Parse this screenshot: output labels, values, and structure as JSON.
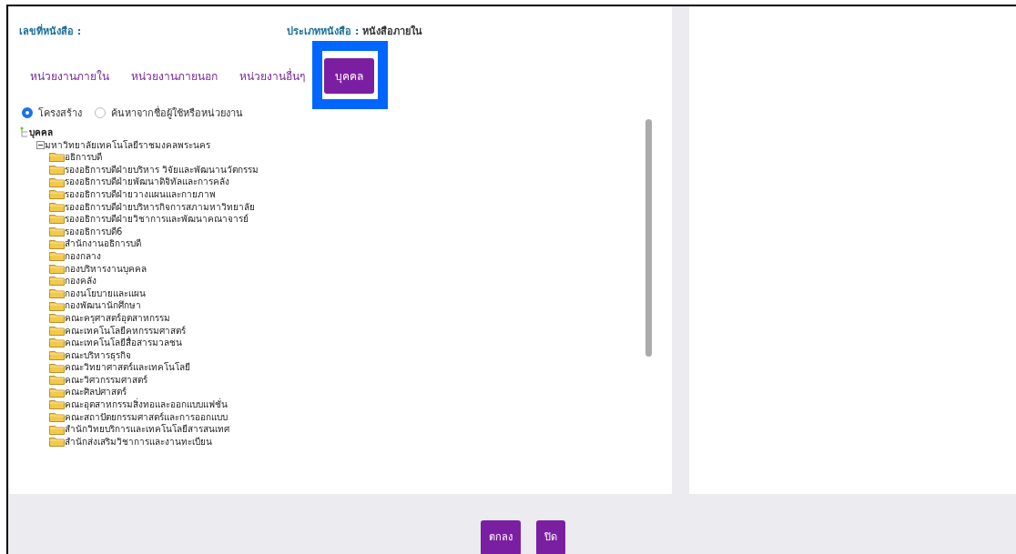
{
  "header": {
    "doc_number_label": "เลขที่หนังสือ :",
    "doc_type_label": "ประเภทหนังสือ :",
    "doc_type_value": "หนังสือภายใน"
  },
  "tabs": [
    {
      "label": "หน่วยงานภายใน",
      "selected": false,
      "highlighted": false
    },
    {
      "label": "หน่วยงานภายนอก",
      "selected": false,
      "highlighted": false
    },
    {
      "label": "หน่วยงานอื่นๆ",
      "selected": false,
      "highlighted": false
    },
    {
      "label": "บุคคล",
      "selected": true,
      "highlighted": true
    }
  ],
  "search_modes": [
    {
      "label": "โครงสร้าง",
      "selected": true
    },
    {
      "label": "ค้นหาจากชื่อผู้ใช้หรือหน่วยงาน",
      "selected": false
    }
  ],
  "tree": {
    "label": "บุคคล",
    "children": [
      {
        "label": "มหาวิทยาลัยเทคโนโลยีราชมงคลพระนคร",
        "expanded": true,
        "children": [
          {
            "label": "อธิการบดี"
          },
          {
            "label": "รองอธิการบดีฝ่ายบริหาร วิจัยและพัฒนานวัตกรรม"
          },
          {
            "label": "รองอธิการบดีฝ่ายพัฒนาดิจิทัลและการคลัง"
          },
          {
            "label": "รองอธิการบดีฝ่ายวางแผนและกายภาพ"
          },
          {
            "label": "รองอธิการบดีฝ่ายบริหารกิจการสภามหาวิทยาลัย"
          },
          {
            "label": "รองอธิการบดีฝ่ายวิชาการและพัฒนาคณาจารย์"
          },
          {
            "label": "รองอธิการบดี6"
          },
          {
            "label": "สำนักงานอธิการบดี"
          },
          {
            "label": "กองกลาง"
          },
          {
            "label": "กองบริหารงานบุคคล"
          },
          {
            "label": "กองคลัง"
          },
          {
            "label": "กองนโยบายและแผน"
          },
          {
            "label": "กองพัฒนานักศึกษา"
          },
          {
            "label": "คณะครุศาสตร์อุตสาหกรรม"
          },
          {
            "label": "คณะเทคโนโลยีคหกรรมศาสตร์"
          },
          {
            "label": "คณะเทคโนโลยีสื่อสารมวลชน"
          },
          {
            "label": "คณะบริหารธุรกิจ"
          },
          {
            "label": "คณะวิทยาศาสตร์และเทคโนโลยี"
          },
          {
            "label": "คณะวิศวกรรมศาสตร์"
          },
          {
            "label": "คณะศิลปศาสตร์"
          },
          {
            "label": "คณะอุตสาหกรรมสิ่งทอและออกแบบแฟชั่น"
          },
          {
            "label": "คณะสถาปัตยกรรมศาสตร์และการออกแบบ"
          },
          {
            "label": "สำนักวิทยบริการและเทคโนโลยีสารสนเทศ"
          },
          {
            "label": "สำนักส่งเสริมวิชาการและงานทะเบียน"
          }
        ]
      }
    ]
  },
  "buttons": [
    "ตกลง",
    "ปิด"
  ]
}
